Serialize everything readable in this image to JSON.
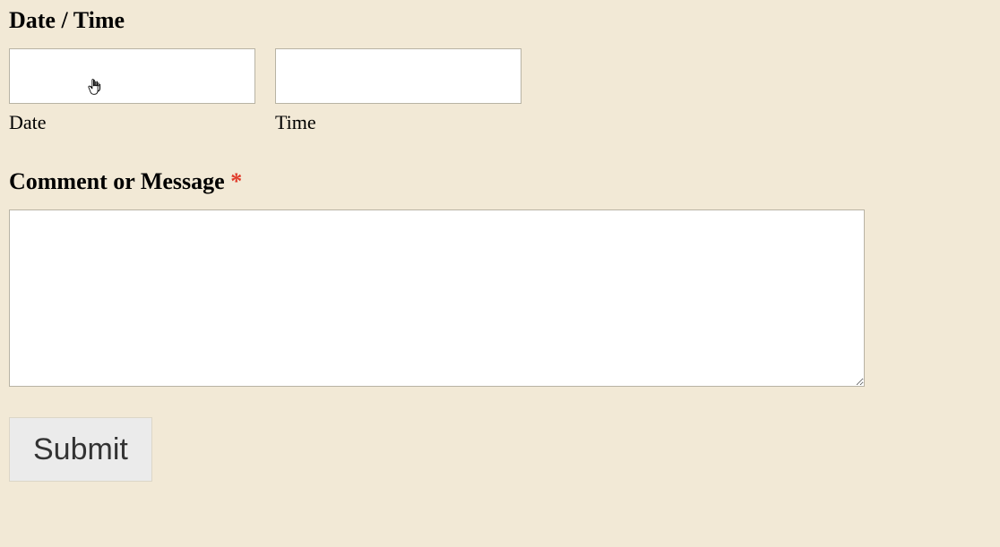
{
  "datetime": {
    "heading": "Date / Time",
    "date_label": "Date",
    "time_label": "Time",
    "date_value": "",
    "time_value": ""
  },
  "message": {
    "heading": "Comment or Message ",
    "required_mark": "*",
    "value": ""
  },
  "actions": {
    "submit_label": "Submit"
  }
}
